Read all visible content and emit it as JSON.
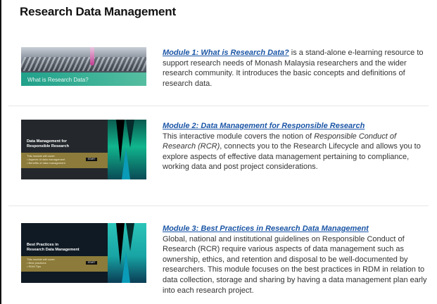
{
  "page": {
    "title": "Research Data Management"
  },
  "modules": [
    {
      "link": "Module 1: What is Research Data?",
      "text": " is a stand-alone e-learning resource to support research needs of Monash Malaysia researchers and the wider research community. It introduces the basic concepts and definitions of research data.",
      "thumb_caption": "What is Research Data?"
    },
    {
      "link": "Module 2: Data Management for Responsible Research",
      "text_a": "This interactive module covers the notion of ",
      "text_em": "Responsible Conduct of Research (RCR)",
      "text_b": ", connects you to the Research Lifecycle and allows you to explore aspects of effective data management pertaining to compliance, working data and post project considerations.",
      "thumb_title_1": "Data Management for",
      "thumb_title_2": "Responsible Research",
      "thumb_sub_1": "This module will cover:",
      "thumb_sub_2": "• Aspects of data management",
      "thumb_sub_3": "• Benefits of data management",
      "thumb_button": "START"
    },
    {
      "link": "Module 3: Best Practices in Research Data Management",
      "text": "Global, national and institutional guidelines on Responsible Conduct of Research (RCR) require various aspects of data management such as ownership, ethics, and retention and disposal to be well-documented by researchers. This module focuses on the best practices in RDM in relation to data collection, storage and sharing by having a data management plan early into each research project.",
      "thumb_title_1": "Best Practices in",
      "thumb_title_2": "Research Data Management",
      "thumb_sub_1": "This module will cover:",
      "thumb_sub_2": "• Best practices",
      "thumb_sub_3": "• RDM Tips",
      "thumb_button": "START"
    }
  ],
  "colors": {
    "link": "#1a55a6",
    "accent_teal": "#10b58d",
    "band_gold": "#8c7b3a"
  }
}
